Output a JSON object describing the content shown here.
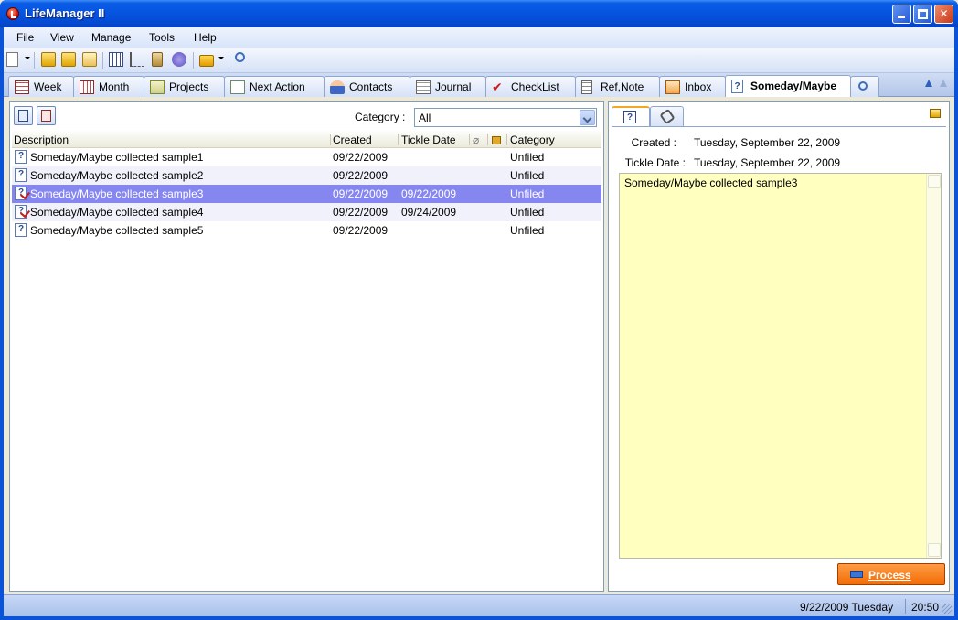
{
  "window": {
    "title": "LifeManager II"
  },
  "menu": [
    {
      "label": "File"
    },
    {
      "label": "View"
    },
    {
      "label": "Manage"
    },
    {
      "label": "Tools"
    },
    {
      "label": "Help"
    }
  ],
  "tabs": [
    {
      "label": "Week",
      "icon": "calendar-week-icon"
    },
    {
      "label": "Month",
      "icon": "calendar-month-icon"
    },
    {
      "label": "Projects",
      "icon": "projects-icon"
    },
    {
      "label": "Next Action",
      "icon": "next-action-icon"
    },
    {
      "label": "Contacts",
      "icon": "contacts-icon"
    },
    {
      "label": "Journal",
      "icon": "journal-icon"
    },
    {
      "label": "CheckList",
      "icon": "checkmark-icon"
    },
    {
      "label": "Ref,Note",
      "icon": "note-icon"
    },
    {
      "label": "Inbox",
      "icon": "inbox-icon"
    },
    {
      "label": "Someday/Maybe",
      "icon": "question-icon"
    }
  ],
  "list": {
    "category_label": "Category :",
    "category_value": "All",
    "columns": {
      "description": "Description",
      "created": "Created",
      "tickle": "Tickle Date",
      "category": "Category"
    },
    "rows": [
      {
        "description": "Someday/Maybe collected sample1",
        "created": "09/22/2009",
        "tickle": "",
        "category": "Unfiled"
      },
      {
        "description": "Someday/Maybe collected sample2",
        "created": "09/22/2009",
        "tickle": "",
        "category": "Unfiled"
      },
      {
        "description": "Someday/Maybe collected sample3",
        "created": "09/22/2009",
        "tickle": "09/22/2009",
        "category": "Unfiled"
      },
      {
        "description": "Someday/Maybe collected sample4",
        "created": "09/22/2009",
        "tickle": "09/24/2009",
        "category": "Unfiled"
      },
      {
        "description": "Someday/Maybe collected sample5",
        "created": "09/22/2009",
        "tickle": "",
        "category": "Unfiled"
      }
    ],
    "selected_index": 2
  },
  "detail": {
    "created_label": "Created :",
    "created_value": "Tuesday, September 22, 2009",
    "tickle_label": "Tickle Date :",
    "tickle_value": "Tuesday, September 22, 2009",
    "note_text": "Someday/Maybe collected sample3",
    "process_label": "Process"
  },
  "status": {
    "date": "9/22/2009 Tuesday",
    "time": "20:50"
  },
  "colors": {
    "selection": "#8686f0",
    "note_bg": "#ffffc0",
    "process_btn": "#f57a10",
    "title_blue": "#0654e0"
  }
}
